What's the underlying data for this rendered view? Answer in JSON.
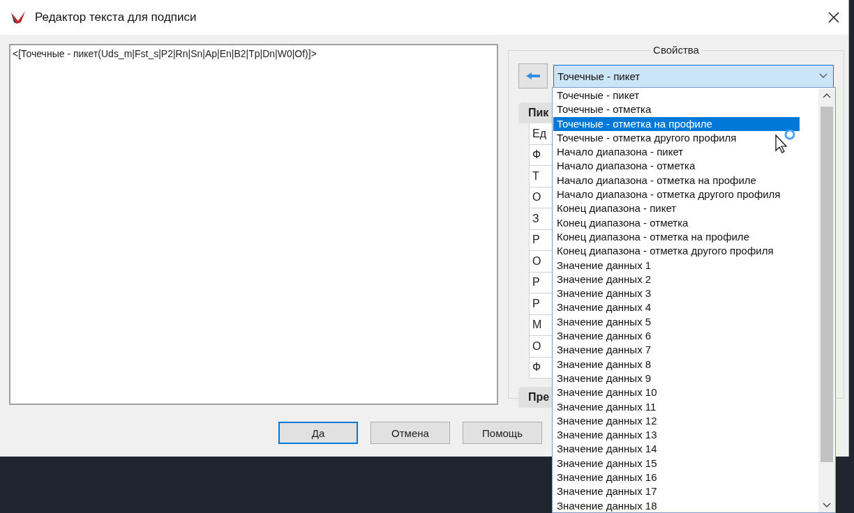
{
  "window": {
    "title": "Редактор текста для подписи"
  },
  "editor": {
    "value": "<[Точечные - пикет(Uds_m|Fst_s|P2|Rn|Sn|Ap|En|B2|Tp|Dn|W0|Of)]>"
  },
  "properties": {
    "title": "Свойства",
    "combo": {
      "value": "Точечные - пикет",
      "expanded": true
    },
    "sections": [
      {
        "label": "Пик",
        "rows": [
          "Ед",
          "Ф",
          "Т",
          "О",
          "З",
          "Р",
          "О",
          "Р",
          "Р",
          "М",
          "О",
          "Ф"
        ]
      },
      {
        "label": "Пре"
      }
    ],
    "options": [
      {
        "label": "Точечные - пикет",
        "selected": false
      },
      {
        "label": "Точечные - отметка",
        "selected": false
      },
      {
        "label": "Точечные - отметка на профиле",
        "selected": true
      },
      {
        "label": "Точечные - отметка другого профиля",
        "selected": false
      },
      {
        "label": "Начало диапазона - пикет",
        "selected": false
      },
      {
        "label": "Начало диапазона - отметка",
        "selected": false
      },
      {
        "label": "Начало диапазона - отметка на профиле",
        "selected": false
      },
      {
        "label": "Начало диапазона - отметка другого профиля",
        "selected": false
      },
      {
        "label": "Конец диапазона - пикет",
        "selected": false
      },
      {
        "label": "Конец диапазона - отметка",
        "selected": false
      },
      {
        "label": "Конец диапазона - отметка на профиле",
        "selected": false
      },
      {
        "label": "Конец диапазона - отметка другого профиля",
        "selected": false
      },
      {
        "label": "Значение данных 1",
        "selected": false
      },
      {
        "label": "Значение данных 2",
        "selected": false
      },
      {
        "label": "Значение данных 3",
        "selected": false
      },
      {
        "label": "Значение данных 4",
        "selected": false
      },
      {
        "label": "Значение данных 5",
        "selected": false
      },
      {
        "label": "Значение данных 6",
        "selected": false
      },
      {
        "label": "Значение данных 7",
        "selected": false
      },
      {
        "label": "Значение данных 8",
        "selected": false
      },
      {
        "label": "Значение данных 9",
        "selected": false
      },
      {
        "label": "Значение данных 10",
        "selected": false
      },
      {
        "label": "Значение данных 11",
        "selected": false
      },
      {
        "label": "Значение данных 12",
        "selected": false
      },
      {
        "label": "Значение данных 13",
        "selected": false
      },
      {
        "label": "Значение данных 14",
        "selected": false
      },
      {
        "label": "Значение данных 15",
        "selected": false
      },
      {
        "label": "Значение данных 16",
        "selected": false
      },
      {
        "label": "Значение данных 17",
        "selected": false
      },
      {
        "label": "Значение данных 18",
        "selected": false
      }
    ]
  },
  "buttons": [
    {
      "label": "Да",
      "focused": true
    },
    {
      "label": "Отмена",
      "focused": false
    },
    {
      "label": "Помощь",
      "focused": false
    }
  ]
}
